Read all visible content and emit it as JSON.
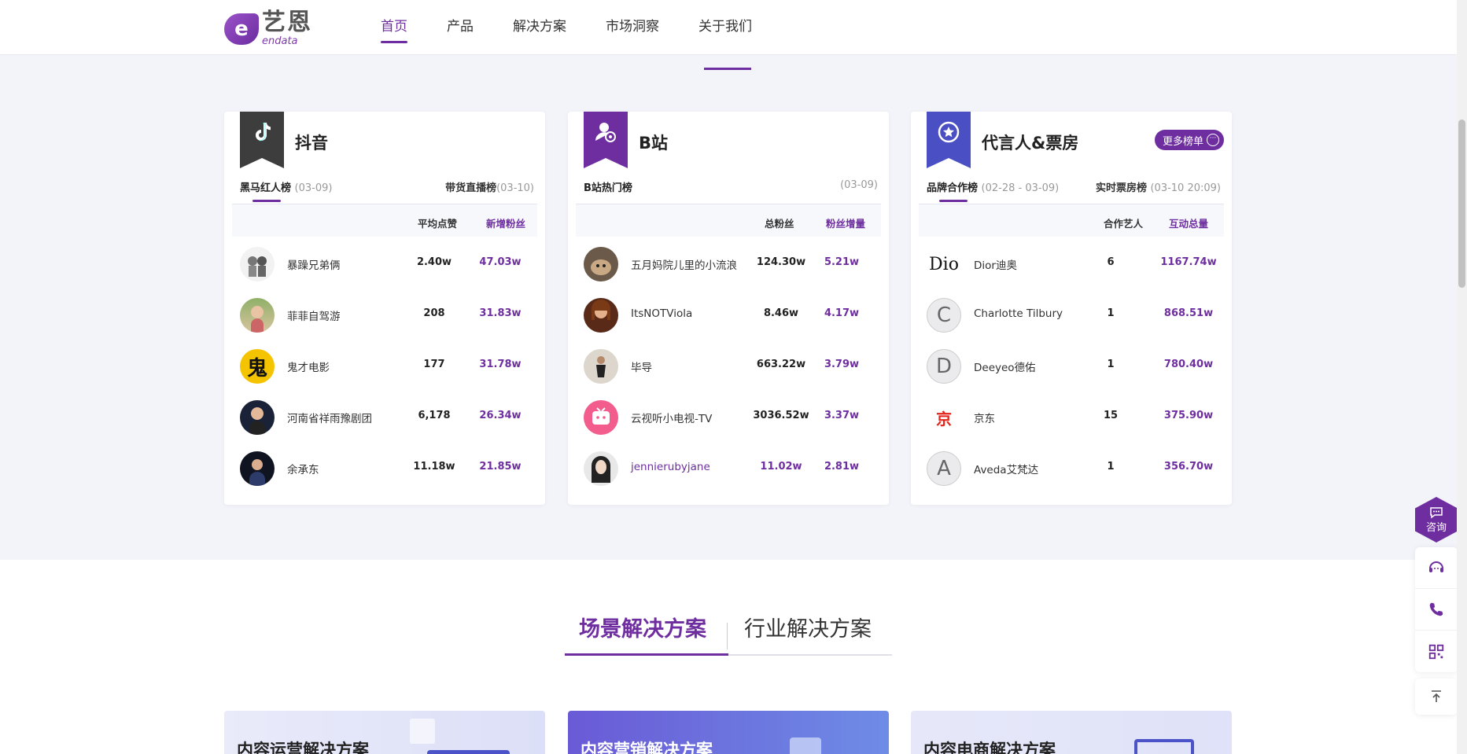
{
  "brand": {
    "cn": "艺恩",
    "en": "endata",
    "mark": "e"
  },
  "nav": [
    {
      "label": "首页",
      "active": true
    },
    {
      "label": "产品"
    },
    {
      "label": "解决方案"
    },
    {
      "label": "市场洞察"
    },
    {
      "label": "关于我们"
    }
  ],
  "cards": [
    {
      "title": "抖音",
      "tab_left": "黑马红人榜",
      "tab_left_date": "(03-09)",
      "tab_right": "带货直播榜",
      "tab_right_date": "(03-10)",
      "col1": "平均点赞",
      "col2": "新增粉丝",
      "rows": [
        {
          "name": "暴躁兄弟俩",
          "v1": "2.40w",
          "v2": "47.03w"
        },
        {
          "name": "菲菲自驾游",
          "v1": "208",
          "v2": "31.83w"
        },
        {
          "name": "鬼才电影",
          "v1": "177",
          "v2": "31.78w",
          "avatar_text": "鬼"
        },
        {
          "name": "河南省祥雨豫剧团",
          "v1": "6,178",
          "v2": "26.34w"
        },
        {
          "name": "余承东",
          "v1": "11.18w",
          "v2": "21.85w"
        }
      ]
    },
    {
      "title": "B站",
      "tab_left": "B站热门榜",
      "tab_left_date": "",
      "tab_right": "",
      "tab_right_date": "(03-09)",
      "col1": "总粉丝",
      "col2": "粉丝增量",
      "rows": [
        {
          "name": "五月妈院儿里的小流浪",
          "v1": "124.30w",
          "v2": "5.21w"
        },
        {
          "name": "ItsNOTViola",
          "v1": "8.46w",
          "v2": "4.17w"
        },
        {
          "name": "毕导",
          "v1": "663.22w",
          "v2": "3.79w"
        },
        {
          "name": "云视听小电视-TV",
          "v1": "3036.52w",
          "v2": "3.37w"
        },
        {
          "name": "jennierubyjane",
          "v1": "11.02w",
          "v2": "2.81w"
        }
      ]
    },
    {
      "title": "代言人&票房",
      "more": "更多榜单",
      "more_icon": "···",
      "tab_left": "品牌合作榜",
      "tab_left_date": "(02-28 - 03-09)",
      "tab_right": "实时票房榜",
      "tab_right_date": "(03-10 20:09)",
      "col1": "合作艺人",
      "col2": "互动总量",
      "rows": [
        {
          "name": "Dior迪奥",
          "v1": "6",
          "v2": "1167.74w",
          "avatar_text": "Dio"
        },
        {
          "name": "Charlotte Tilbury",
          "v1": "1",
          "v2": "868.51w",
          "avatar_text": "C"
        },
        {
          "name": "Deeyeo德佑",
          "v1": "1",
          "v2": "780.40w",
          "avatar_text": "D"
        },
        {
          "name": "京东",
          "v1": "15",
          "v2": "375.90w",
          "avatar_text": "京"
        },
        {
          "name": "Aveda艾梵达",
          "v1": "1",
          "v2": "356.70w",
          "avatar_text": "A"
        }
      ]
    }
  ],
  "solutions": {
    "tab_active": "场景解决方案",
    "tab_other": "行业解决方案",
    "cards": [
      "内容运营解决方案",
      "内容营销解决方案",
      "内容电商解决方案"
    ]
  },
  "side": {
    "consult": "咨询"
  },
  "colors": {
    "accent": "#6e2ea0",
    "douyin_badge": "#3d3d3d",
    "bili_badge": "#6e2ea0",
    "star_badge": "#4a4fc4"
  }
}
